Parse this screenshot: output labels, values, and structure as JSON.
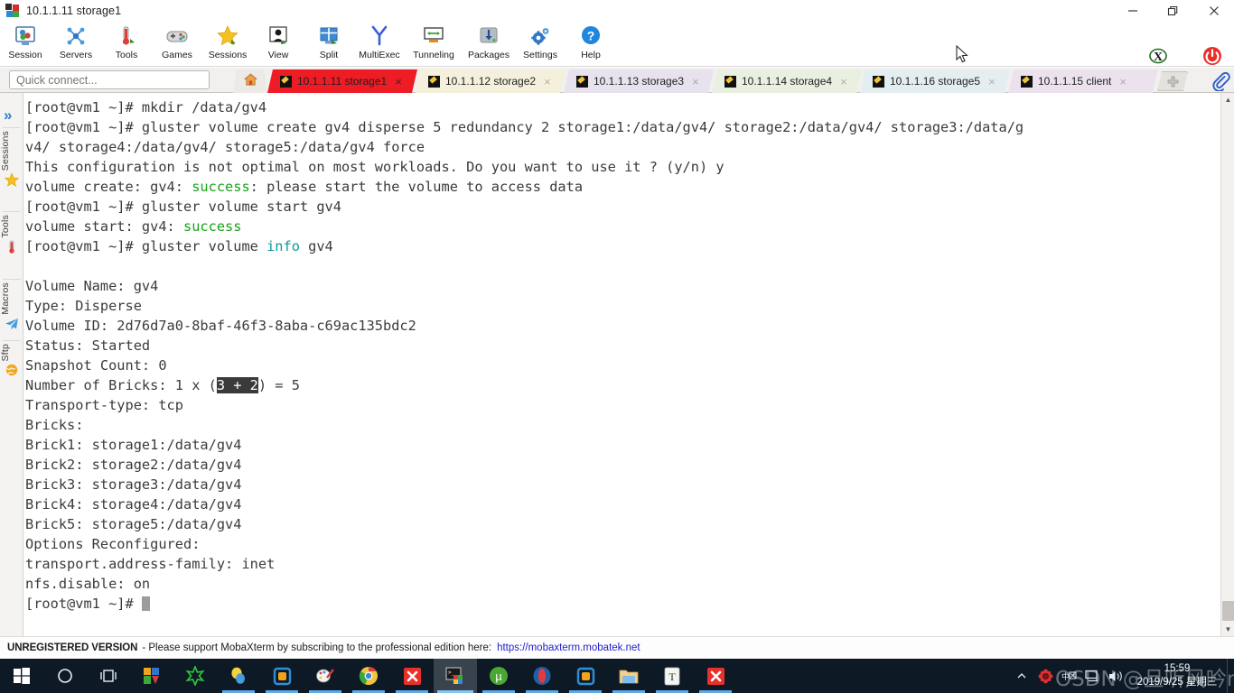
{
  "window": {
    "title": "10.1.1.11 storage1",
    "app_icon": "mobaxterm-icon",
    "minimize_label": "Minimize",
    "maximize_label": "Restore",
    "close_label": "Close"
  },
  "toolbar": {
    "items": [
      {
        "label": "Session",
        "icon": "session-icon"
      },
      {
        "label": "Servers",
        "icon": "servers-icon"
      },
      {
        "label": "Tools",
        "icon": "tools-icon"
      },
      {
        "label": "Games",
        "icon": "games-icon"
      },
      {
        "label": "Sessions",
        "icon": "sessions-star-icon"
      },
      {
        "label": "View",
        "icon": "view-icon"
      },
      {
        "label": "Split",
        "icon": "split-icon"
      },
      {
        "label": "MultiExec",
        "icon": "multiexec-icon"
      },
      {
        "label": "Tunneling",
        "icon": "tunneling-icon"
      },
      {
        "label": "Packages",
        "icon": "packages-icon"
      },
      {
        "label": "Settings",
        "icon": "settings-gear-icon"
      },
      {
        "label": "Help",
        "icon": "help-question-icon"
      }
    ],
    "right_items": [
      {
        "label": "X server",
        "icon": "x-server-icon"
      },
      {
        "label": "Exit",
        "icon": "power-exit-icon"
      }
    ]
  },
  "quick_connect": {
    "placeholder": "Quick connect...",
    "value": ""
  },
  "tabs": {
    "home_icon": "home-icon",
    "add_label": "+",
    "paperclip_icon": "paperclip-icon",
    "items": [
      {
        "label": "10.1.1.11 storage1",
        "active": true,
        "color": "#ee1c25",
        "close": "×"
      },
      {
        "label": "10.1.1.12 storage2",
        "active": false,
        "color": "#f5f0dc",
        "close": "×"
      },
      {
        "label": "10.1.1.13 storage3",
        "active": false,
        "color": "#e7e2ee",
        "close": "×"
      },
      {
        "label": "10.1.1.14 storage4",
        "active": false,
        "color": "#e9f0e2",
        "close": "×"
      },
      {
        "label": "10.1.1.16 storage5",
        "active": false,
        "color": "#e4eef0",
        "close": "×"
      },
      {
        "label": "10.1.1.15 client",
        "active": false,
        "color": "#ece2ee",
        "close": "×"
      }
    ]
  },
  "sidebar": {
    "expand_icon": "chevron-double-right-icon",
    "items": [
      {
        "label": "Sessions",
        "icon": "star-icon"
      },
      {
        "label": "Tools",
        "icon": "thermometer-icon"
      },
      {
        "label": "Macros",
        "icon": "paper-plane-icon"
      },
      {
        "label": "Sftp",
        "icon": "globe-icon"
      }
    ]
  },
  "terminal": {
    "lines": [
      [
        {
          "t": "[root@vm1 ~]# mkdir /data/gv4"
        }
      ],
      [
        {
          "t": "[root@vm1 ~]# gluster volume create gv4 disperse 5 redundancy 2 storage1:/data/gv4/ storage2:/data/gv4/ storage3:/data/g"
        }
      ],
      [
        {
          "t": "v4/ storage4:/data/gv4/ storage5:/data/gv4 force"
        }
      ],
      [
        {
          "t": "This configuration is not optimal on most workloads. Do you want to use it ? (y/n) y"
        }
      ],
      [
        {
          "t": "volume create: gv4: "
        },
        {
          "t": "success",
          "c": "grn"
        },
        {
          "t": ": please start the volume to access data"
        }
      ],
      [
        {
          "t": "[root@vm1 ~]# gluster volume start gv4"
        }
      ],
      [
        {
          "t": "volume start: gv4: "
        },
        {
          "t": "success",
          "c": "grn"
        }
      ],
      [
        {
          "t": "[root@vm1 ~]# gluster volume "
        },
        {
          "t": "info",
          "c": "cyn"
        },
        {
          "t": " gv4"
        }
      ],
      [
        {
          "t": " "
        }
      ],
      [
        {
          "t": "Volume Name: gv4"
        }
      ],
      [
        {
          "t": "Type: Disperse"
        }
      ],
      [
        {
          "t": "Volume ID: 2d76d7a0-8baf-46f3-8aba-c69ac135bdc2"
        }
      ],
      [
        {
          "t": "Status: Started"
        }
      ],
      [
        {
          "t": "Snapshot Count: 0"
        }
      ],
      [
        {
          "t": "Number of Bricks: 1 x ("
        },
        {
          "t": "3 + 2",
          "c": "sel"
        },
        {
          "t": ") = 5"
        }
      ],
      [
        {
          "t": "Transport-type: tcp"
        }
      ],
      [
        {
          "t": "Bricks:"
        }
      ],
      [
        {
          "t": "Brick1: storage1:/data/gv4"
        }
      ],
      [
        {
          "t": "Brick2: storage2:/data/gv4"
        }
      ],
      [
        {
          "t": "Brick3: storage3:/data/gv4"
        }
      ],
      [
        {
          "t": "Brick4: storage4:/data/gv4"
        }
      ],
      [
        {
          "t": "Brick5: storage5:/data/gv4"
        }
      ],
      [
        {
          "t": "Options Reconfigured:"
        }
      ],
      [
        {
          "t": "transport.address-family: inet"
        }
      ],
      [
        {
          "t": "nfs.disable: on"
        }
      ],
      [
        {
          "t": "[root@vm1 ~]# ",
          "cursor": true
        }
      ]
    ],
    "colors": {
      "foreground": "#3b3b3b",
      "background": "#ffffff",
      "success_green": "#18a218",
      "info_cyan": "#0d9b9b",
      "selection_bg": "#3a3a3a"
    }
  },
  "status_bar": {
    "badge": "UNREGISTERED VERSION",
    "message": "-  Please support MobaXterm by subscribing to the professional edition here:",
    "link": "https://mobaxterm.mobatek.net"
  },
  "taskbar": {
    "items": [
      {
        "icon": "windows-start-icon",
        "state": "none"
      },
      {
        "icon": "cortana-circle-icon",
        "state": "none"
      },
      {
        "icon": "task-view-icon",
        "state": "none"
      },
      {
        "icon": "office-icon",
        "state": "none"
      },
      {
        "icon": "green-star-icon",
        "state": "none"
      },
      {
        "icon": "balloon-icon",
        "state": "running"
      },
      {
        "icon": "vmware-player-icon",
        "state": "running"
      },
      {
        "icon": "paint-icon",
        "state": "running"
      },
      {
        "icon": "chrome-icon",
        "state": "running"
      },
      {
        "icon": "xmind-icon",
        "state": "running"
      },
      {
        "icon": "mobaxterm-icon",
        "state": "active"
      },
      {
        "icon": "utorrent-icon",
        "state": "running"
      },
      {
        "icon": "opera-icon",
        "state": "running"
      },
      {
        "icon": "vmware-icon",
        "state": "running"
      },
      {
        "icon": "file-explorer-icon",
        "state": "running"
      },
      {
        "icon": "typora-icon",
        "state": "running"
      },
      {
        "icon": "xmind-red-icon",
        "state": "running"
      }
    ],
    "tray": [
      {
        "icon": "chevron-up-icon"
      },
      {
        "icon": "red-flower-icon"
      },
      {
        "icon": "keyboard-ime-icon"
      },
      {
        "icon": "network-icon"
      },
      {
        "icon": "volume-icon"
      }
    ],
    "clock": {
      "time": "15:59",
      "date": "2019/9/25 星期三"
    },
    "watermark": "OSDN @旦听风吟nj"
  }
}
